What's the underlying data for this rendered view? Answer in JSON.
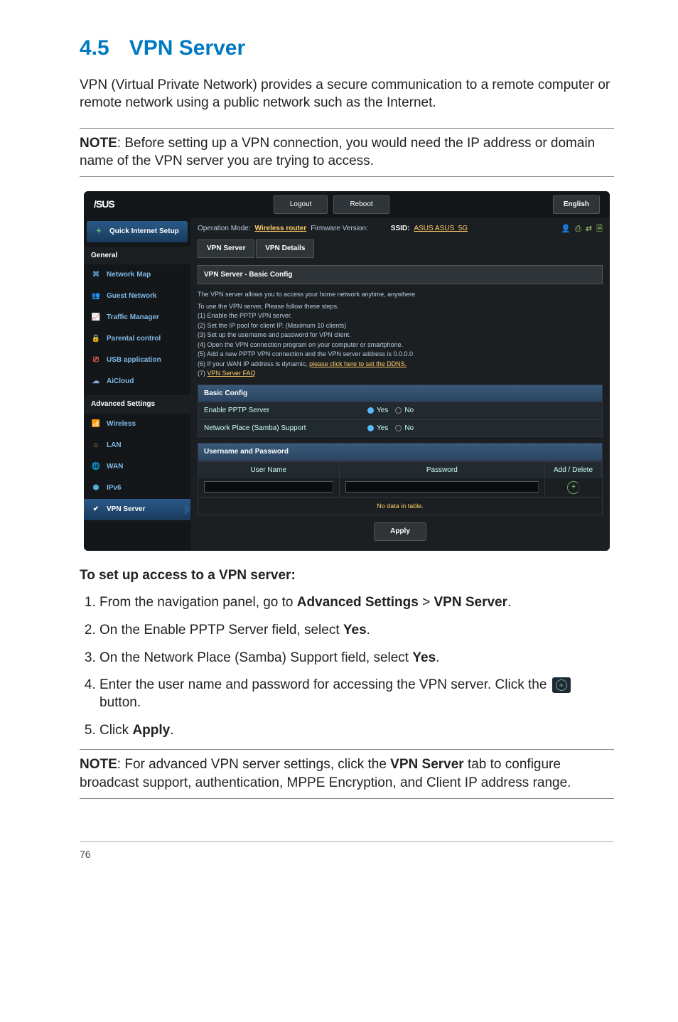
{
  "title_num": "4.5",
  "title_text": "VPN Server",
  "intro": "VPN (Virtual Private Network) provides a secure communication to a remote computer or remote network using a public network such as the Internet.",
  "note1": {
    "label": "NOTE",
    "text": ":  Before setting up a VPN connection, you would need the IP address or domain name of the VPN server you are trying to access."
  },
  "screenshot": {
    "logo": "/SUS",
    "logout": "Logout",
    "reboot": "Reboot",
    "language": "English",
    "opmode_label": "Operation Mode:",
    "opmode_value": "Wireless router",
    "fw_label": "Firmware Version:",
    "ssid_label": "SSID:",
    "ssid_value": "ASUS  ASUS_5G",
    "tabs": {
      "server": "VPN Server",
      "details": "VPN Details"
    },
    "panel_title": "VPN Server - Basic Config",
    "desc": "The VPN server allows you to access your home network anytime, anywhere.",
    "list_intro": "To use the VPN server, Please follow these steps.",
    "list": [
      "(1) Enable the PPTP VPN server.",
      "(2) Set the IP pool for client IP. (Maximum 10 clients)",
      "(3) Set up the username and password for VPN client.",
      "(4) Open the VPN connection program on your computer or smartphone.",
      "(5) Add a new PPTP VPN connection and the VPN server address is 0.0.0.0",
      "(6) If your WAN IP address is dynamic, please click here to set the DDNS.",
      "(7) VPN Server FAQ"
    ],
    "sub_basic": "Basic Config",
    "row_pptp": "Enable PPTP Server",
    "row_samba": "Network Place (Samba) Support",
    "yes": "Yes",
    "no": "No",
    "sub_user": "Username and Password",
    "th_user": "User Name",
    "th_pass": "Password",
    "th_add": "Add / Delete",
    "nodata": "No data in table.",
    "apply": "Apply",
    "sidebar": {
      "qis": "Quick Internet Setup",
      "general": "General",
      "items_general": [
        "Network Map",
        "Guest Network",
        "Traffic Manager",
        "Parental control",
        "USB application",
        "AiCloud"
      ],
      "advanced": "Advanced Settings",
      "items_adv": [
        "Wireless",
        "LAN",
        "WAN",
        "IPv6",
        "VPN Server"
      ]
    }
  },
  "steps_title": "To set up access to a VPN server:",
  "steps": {
    "s1a": "From the navigation panel, go to ",
    "s1b": "Advanced Settings",
    "s1c": " > ",
    "s1d": "VPN Server",
    "s1e": ".",
    "s2a": "On the Enable PPTP Server field, select ",
    "s2b": "Yes",
    "s2c": ".",
    "s3a": "On the Network Place (Samba) Support field, select ",
    "s3b": "Yes",
    "s3c": ".",
    "s4a": "Enter the user name and password for accessing the VPN server. Click the ",
    "s4b": " button.",
    "s5a": "Click ",
    "s5b": "Apply",
    "s5c": "."
  },
  "note2": {
    "label": "NOTE",
    "text_a": ":  For advanced VPN server settings, click the ",
    "text_b": "VPN Server",
    "text_c": " tab to configure broadcast support, authentication, MPPE Encryption, and Client IP address range."
  },
  "page_number": "76"
}
